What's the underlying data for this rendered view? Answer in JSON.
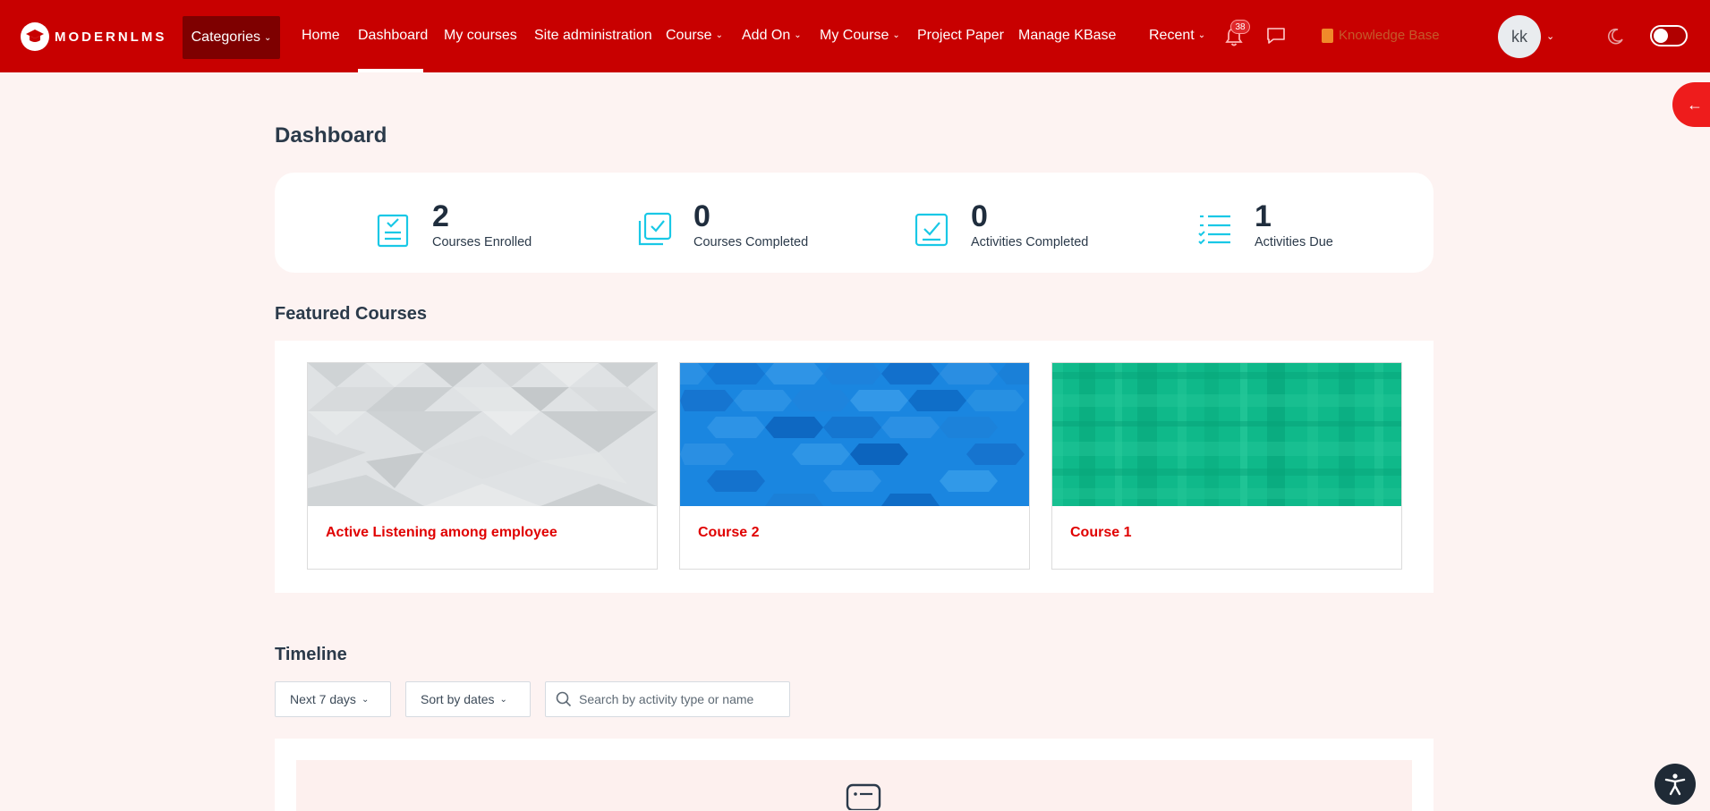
{
  "brand": {
    "logo_text": "MODERNLMS"
  },
  "nav": {
    "categories": "Categories",
    "home": "Home",
    "dashboard": "Dashboard",
    "my_courses": "My courses",
    "site_admin": "Site administration",
    "course": "Course",
    "add_on": "Add On",
    "my_course": "My Course",
    "project_paper": "Project Paper",
    "manage_kbase": "Manage KBase",
    "recent": "Recent",
    "notification_count": "38",
    "knowledge_base": "Knowledge Base",
    "avatar_initials": "kk"
  },
  "page": {
    "title": "Dashboard"
  },
  "stats": [
    {
      "value": "2",
      "label": "Courses Enrolled"
    },
    {
      "value": "0",
      "label": "Courses Completed"
    },
    {
      "value": "0",
      "label": "Activities Completed"
    },
    {
      "value": "1",
      "label": "Activities Due"
    }
  ],
  "featured": {
    "title": "Featured Courses",
    "courses": [
      {
        "title": "Active Listening among employee"
      },
      {
        "title": "Course 2"
      },
      {
        "title": "Course 1"
      }
    ]
  },
  "timeline": {
    "title": "Timeline",
    "range_filter": "Next 7 days",
    "sort_filter": "Sort by dates",
    "search_placeholder": "Search by activity type or name"
  },
  "colors": {
    "navbar": "#c80000",
    "accent_icon": "#19c8e6",
    "course_title": "#e00000"
  }
}
